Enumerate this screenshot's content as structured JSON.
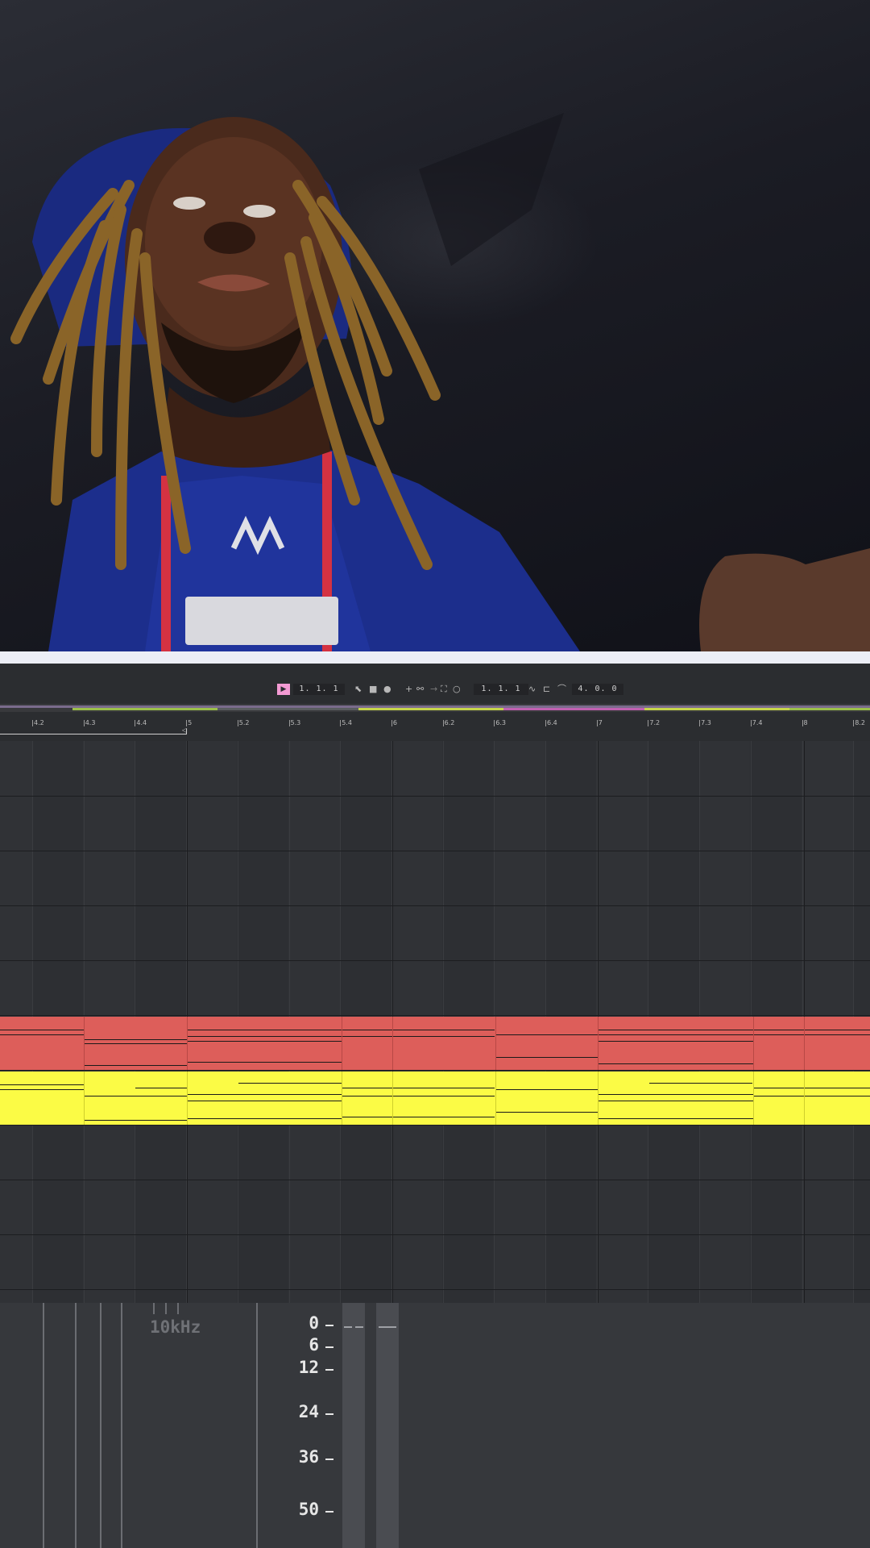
{
  "transport": {
    "play_icon": "play-icon",
    "position": "1. 1. 1",
    "loop_start": "1. 1. 1",
    "loop_length": "4. 0. 0",
    "icons": [
      "cursor-icon",
      "stop-icon",
      "record-icon",
      "add-icon",
      "link-icon",
      "arrow-icon",
      "loop-region-icon",
      "circle-icon",
      "curve-icon",
      "loop-icon",
      "automation-icon"
    ]
  },
  "ruler": {
    "labels": [
      "4.2",
      "4.3",
      "4.4",
      "5",
      "5.2",
      "5.3",
      "5.4",
      "6",
      "6.2",
      "6.3",
      "6.4",
      "7",
      "7.2",
      "7.3",
      "7.4",
      "8",
      "8.2"
    ]
  },
  "analyzer": {
    "freq_label": "10kHz",
    "db_labels": [
      "0",
      "6",
      "12",
      "24",
      "36",
      "50"
    ]
  },
  "colors": {
    "accent_pink": "#f39ad3",
    "clip_red": "#dd5e5a",
    "clip_yellow": "#fbfb45",
    "background": "#2d2f33"
  }
}
